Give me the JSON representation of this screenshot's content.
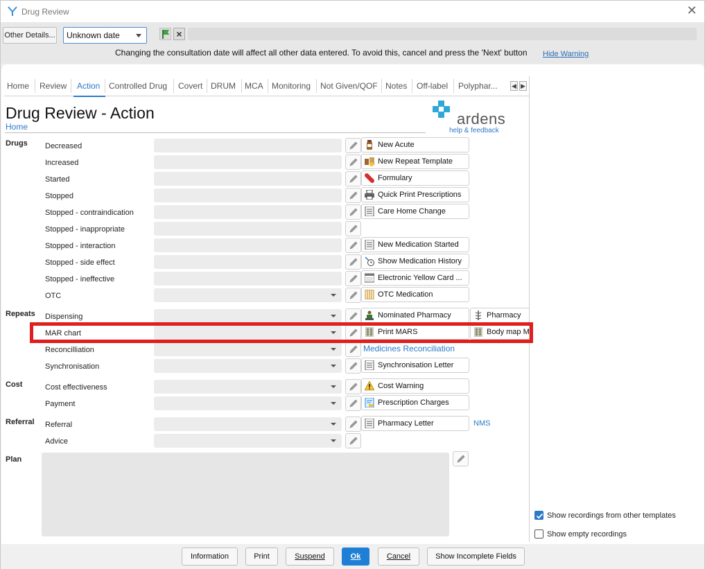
{
  "window": {
    "title": "Drug Review"
  },
  "toolbar": {
    "other_details": "Other Details...",
    "date_value": "Unknown date",
    "warning": "Changing the consultation date will affect all other data entered. To avoid this, cancel and press the 'Next' button",
    "hide_warning": "Hide Warning"
  },
  "tabs": [
    "Home",
    "Review",
    "Action",
    "Controlled Drug",
    "Covert",
    "DRUM",
    "MCA",
    "Monitoring",
    "Not Given/QOF",
    "Notes",
    "Off-label",
    "Polyphar..."
  ],
  "active_tab": "Action",
  "page": {
    "title": "Drug Review - Action",
    "home_link": "Home",
    "logo_text": "ardens",
    "help_link": "help & feedback"
  },
  "sections": {
    "drugs": "Drugs",
    "repeats": "Repeats",
    "cost": "Cost",
    "referral": "Referral",
    "plan": "Plan"
  },
  "rows": {
    "decreased": "Decreased",
    "increased": "Increased",
    "started": "Started",
    "stopped": "Stopped",
    "stopped_contra": "Stopped - contraindication",
    "stopped_inappropriate": "Stopped - inappropriate",
    "stopped_interaction": "Stopped - interaction",
    "stopped_side_effect": "Stopped - side effect",
    "stopped_ineffective": "Stopped - ineffective",
    "otc": "OTC",
    "dispensing": "Dispensing",
    "mar_chart": "MAR chart",
    "reconcilliation": "Reconcilliation",
    "synchronisation": "Synchronisation",
    "cost_effectiveness": "Cost effectiveness",
    "payment": "Payment",
    "referral": "Referral",
    "advice": "Advice"
  },
  "actions": {
    "new_acute": "New Acute",
    "new_repeat_template": "New Repeat Template",
    "formulary": "Formulary",
    "quick_print": "Quick Print Prescriptions",
    "care_home_change": "Care Home Change",
    "new_medication_started": "New Medication Started",
    "show_medication_history": "Show Medication History",
    "electronic_yellow_card": "Electronic Yellow Card ...",
    "otc_medication": "OTC Medication",
    "nominated_pharmacy": "Nominated Pharmacy",
    "pharmacy": "Pharmacy",
    "print_mars": "Print MARS",
    "body_map": "Body map M.",
    "medicines_reconciliation": "Medicines Reconciliation",
    "synchronisation_letter": "Synchronisation Letter",
    "cost_warning": "Cost Warning",
    "prescription_charges": "Prescription Charges",
    "pharmacy_letter": "Pharmacy Letter",
    "nms": "NMS"
  },
  "options": {
    "show_other_templates": "Show recordings from other templates",
    "show_other_templates_checked": true,
    "show_empty": "Show empty recordings",
    "show_empty_checked": false
  },
  "footer": {
    "information": "Information",
    "print": "Print",
    "suspend": "Suspend",
    "ok": "Ok",
    "cancel": "Cancel",
    "show_incomplete": "Show Incomplete Fields"
  },
  "colors": {
    "accent": "#2a7ac8",
    "primary_button": "#1f7fd6",
    "highlight": "#e01e1e",
    "field_bg": "#ececec"
  }
}
